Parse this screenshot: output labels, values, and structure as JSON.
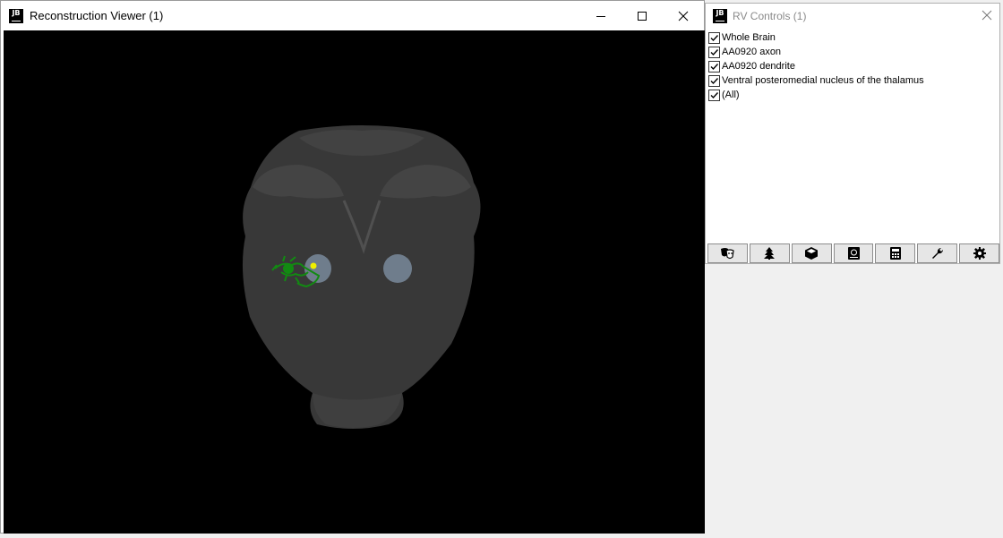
{
  "viewer": {
    "title": "Reconstruction Viewer (1)",
    "icon_label": "JB"
  },
  "controls": {
    "title": "RV Controls (1)",
    "icon_label": "JB",
    "items": [
      {
        "label": "Whole Brain",
        "checked": true
      },
      {
        "label": "AA0920 axon",
        "checked": true
      },
      {
        "label": "AA0920 dendrite",
        "checked": true
      },
      {
        "label": "Ventral posteromedial nucleus of the thalamus",
        "checked": true
      },
      {
        "label": "(All)",
        "checked": true
      }
    ],
    "toolbar": [
      "theater-masks-icon",
      "tree-icon",
      "cube-icon",
      "atlas-book-icon",
      "calculator-icon",
      "wrench-icon",
      "gear-icon"
    ]
  },
  "colors": {
    "brain": "#3a3a3a",
    "nucleus": "#708090",
    "axon": "#1a8a1a",
    "dendrite": "#e8e800"
  }
}
